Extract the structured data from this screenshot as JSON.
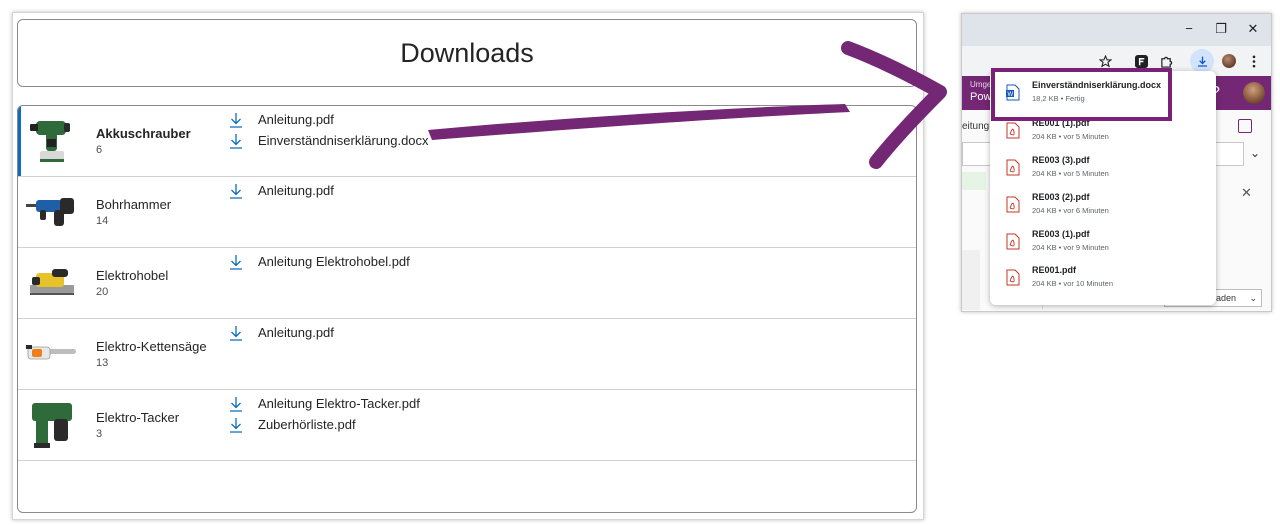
{
  "downloads_app": {
    "title": "Downloads",
    "tools": [
      {
        "name": "Akkuschrauber",
        "count": "6",
        "selected": true,
        "icon": "drill-icon",
        "files": [
          "Anleitung.pdf",
          "Einverständniserklärung.docx"
        ]
      },
      {
        "name": "Bohrhammer",
        "count": "14",
        "icon": "hammer-drill-icon",
        "files": [
          "Anleitung.pdf"
        ]
      },
      {
        "name": "Elektrohobel",
        "count": "20",
        "icon": "planer-icon",
        "files": [
          "Anleitung Elektrohobel.pdf"
        ]
      },
      {
        "name": "Elektro-Kettensäge",
        "count": "13",
        "icon": "chainsaw-icon",
        "files": [
          "Anleitung.pdf"
        ]
      },
      {
        "name": "Elektro-Tacker",
        "count": "3",
        "icon": "stapler-icon",
        "files": [
          "Anleitung Elektro-Tacker.pdf",
          "Zuberhörliste.pdf"
        ]
      }
    ]
  },
  "browser": {
    "window_controls": {
      "minimize": "−",
      "restore": "❐",
      "close": "✕"
    },
    "background": {
      "header_small": "Umge",
      "header_app": "Pow",
      "side_text": "eitung",
      "help": "?",
      "select_text": "rladen"
    },
    "downloads_popup": [
      {
        "name": "Einverständniserklärung.docx",
        "meta": "18,2 KB • Fertig",
        "type": "word"
      },
      {
        "name": "RE001 (1).pdf",
        "meta": "204 KB • vor 5 Minuten",
        "type": "pdf"
      },
      {
        "name": "RE003 (3).pdf",
        "meta": "204 KB • vor 5 Minuten",
        "type": "pdf"
      },
      {
        "name": "RE003 (2).pdf",
        "meta": "204 KB • vor 6 Minuten",
        "type": "pdf"
      },
      {
        "name": "RE003 (1).pdf",
        "meta": "204 KB • vor 9 Minuten",
        "type": "pdf"
      },
      {
        "name": "RE001.pdf",
        "meta": "204 KB • vor 10 Minuten",
        "type": "pdf"
      }
    ]
  },
  "colors": {
    "accent": "#0f6cbd",
    "annotation": "#742774",
    "power_apps_purple": "#742774"
  }
}
